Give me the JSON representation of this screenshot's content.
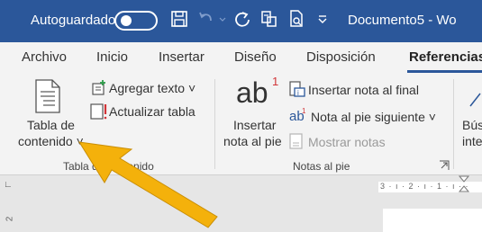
{
  "titlebar": {
    "autosave_label": "Autoguardado",
    "document_title": "Documento5  -  Wo"
  },
  "tabs": [
    {
      "label": "Archivo"
    },
    {
      "label": "Inicio"
    },
    {
      "label": "Insertar"
    },
    {
      "label": "Diseño"
    },
    {
      "label": "Disposición"
    },
    {
      "label": "Referencias"
    }
  ],
  "ribbon": {
    "toc": {
      "label_line1": "Tabla de",
      "label_line2": "contenido ˅",
      "add_text": "Agregar texto ˅",
      "update_table": "Actualizar tabla",
      "group_label": "Tabla de contenido"
    },
    "footnotes": {
      "ab_glyph": "ab",
      "ab_sup": "1",
      "insert_line1": "Insertar",
      "insert_line2": "nota al pie",
      "insert_endnote": "Insertar nota al final",
      "next_footnote": "Nota al pie siguiente  ˅",
      "show_notes": "Mostrar notas",
      "group_label": "Notas al pie"
    },
    "research": {
      "label_line1": "Bús",
      "label_line2": "inte"
    }
  },
  "ruler": {
    "text": "3 · ı · 2 · ı · 1 · ı · ·"
  },
  "vruler": {
    "number": "2"
  },
  "colors": {
    "title_bar": "#2b579a",
    "ribbon": "#f3f3f3",
    "arrow": "#f4b10b"
  }
}
